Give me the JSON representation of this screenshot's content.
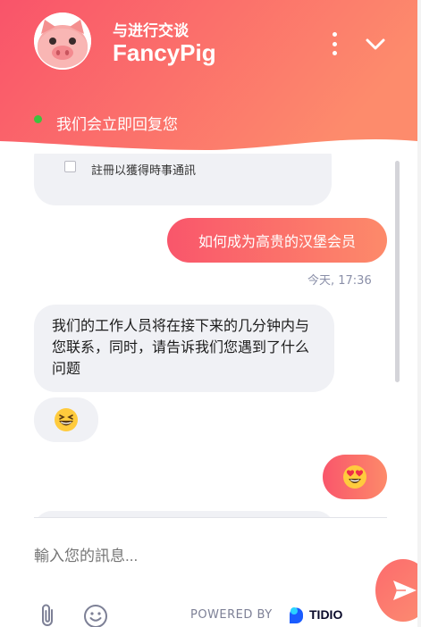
{
  "header": {
    "subtitle": "与进行交谈",
    "title": "FancyPig",
    "status_text": "我们会立即回复您",
    "gradient_start": "#f9546a",
    "gradient_end": "#fd8b6c",
    "online_color": "#3ec13e",
    "icons": {
      "avatar": "pig-avatar-icon",
      "menu": "more-vertical-icon",
      "collapse": "chevron-down-icon"
    }
  },
  "form_card": {
    "checkbox_label": "註冊以獲得時事通訊",
    "checked": false
  },
  "messages": [
    {
      "from": "visitor",
      "text": "如何成为高贵的汉堡会员",
      "time": "今天, 17:36"
    },
    {
      "from": "operator",
      "text": "我们的工作人员将在接下来的几分钟内与您联系，同时，请告诉我们您遇到了什么问题"
    },
    {
      "from": "operator",
      "emoji": "grinning-squinting-face-emoji"
    },
    {
      "from": "visitor",
      "emoji": "heart-eyes-face-emoji"
    }
  ],
  "composer": {
    "placeholder": "輸入您的訊息...",
    "powered_by": "POWERED BY",
    "brand": "TIDIO",
    "icons": {
      "attach": "paperclip-icon",
      "emoji": "smile-icon",
      "send": "send-icon"
    }
  }
}
